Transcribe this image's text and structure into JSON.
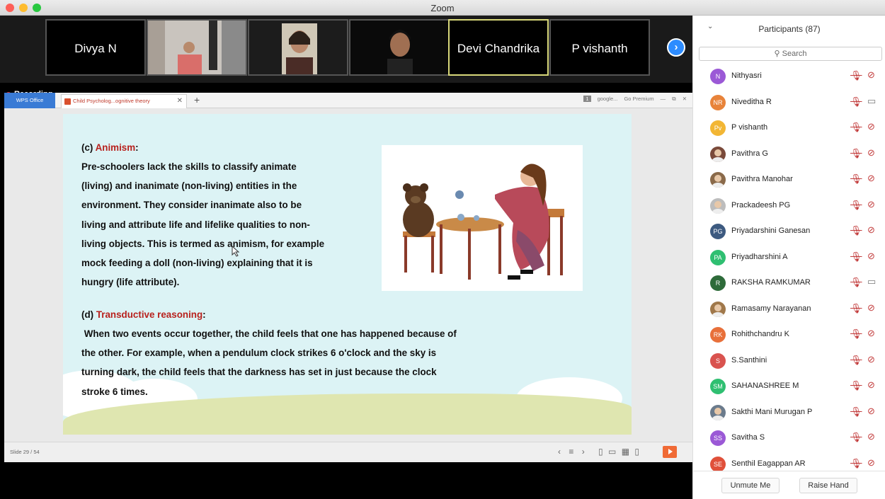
{
  "window": {
    "title": "Zoom"
  },
  "gallery": {
    "tiles": [
      {
        "name": "Divya N",
        "type": "name",
        "active": false
      },
      {
        "name": "",
        "type": "video",
        "active": false
      },
      {
        "name": "",
        "type": "video",
        "active": false
      },
      {
        "name": "",
        "type": "video",
        "active": false
      },
      {
        "name": "Devi Chandrika",
        "type": "name",
        "active": true
      },
      {
        "name": "P vishanth",
        "type": "name",
        "active": false
      }
    ],
    "next_icon": "chevron-right-icon"
  },
  "recording": {
    "label": "Recording"
  },
  "wps": {
    "app_tab": "WPS Office",
    "doc_tab": "Child Psycholog...ognitive theory",
    "new_tab": "+",
    "toolbar_right": {
      "page_box": "1",
      "google": "google...",
      "premium": "Go Premium"
    },
    "status": {
      "slide_count": "Slide 29 / 54"
    }
  },
  "slide": {
    "c_prefix": "(c) ",
    "c_title": "Animism",
    "c_lines": [
      "Pre-schoolers lack the skills to classify animate",
      "(living) and inanimate (non-living) entities in the",
      "environment. They consider inanimate also to be",
      "living and attribute life and lifelike qualities to non-",
      "living objects. This is termed as animism, for example",
      "mock feeding a doll (non-living) explaining that it is",
      "hungry (life attribute)."
    ],
    "d_prefix": "(d) ",
    "d_title": "Transductive reasoning",
    "d_lines": [
      " When two events occur together, the child feels that one has happened because of",
      "the other. For example, when a pendulum clock strikes 6 o'clock and the sky is",
      "turning dark, the child feels that the darkness has set in just because the clock",
      "stroke 6 times."
    ],
    "image_alt": "girl-feeding-teddy-bear-illustration"
  },
  "participants": {
    "title": "Participants (87)",
    "search_placeholder": "Search",
    "items": [
      {
        "name": "Nithyasri",
        "initials": "N",
        "color": "#9b59d6",
        "photo": false,
        "cam_on": false
      },
      {
        "name": "Niveditha R",
        "initials": "NR",
        "color": "#e8833a",
        "photo": false,
        "cam_on": true
      },
      {
        "name": "P vishanth",
        "initials": "Pv",
        "color": "#f2b634",
        "photo": false,
        "cam_on": false
      },
      {
        "name": "Pavithra G",
        "initials": "",
        "color": "#7a4a3a",
        "photo": true,
        "cam_on": false
      },
      {
        "name": "Pavithra Manohar",
        "initials": "",
        "color": "#8a6a4a",
        "photo": true,
        "cam_on": false
      },
      {
        "name": "Prackadeesh PG",
        "initials": "",
        "color": "#bdbdbd",
        "photo": true,
        "cam_on": false
      },
      {
        "name": "Priyadarshini Ganesan",
        "initials": "PG",
        "color": "#3d5a80",
        "photo": false,
        "cam_on": false
      },
      {
        "name": "Priyadharshini A",
        "initials": "PA",
        "color": "#2fbf71",
        "photo": false,
        "cam_on": false
      },
      {
        "name": "RAKSHA RAMKUMAR",
        "initials": "R",
        "color": "#2e6b3a",
        "photo": false,
        "cam_on": true
      },
      {
        "name": "Ramasamy Narayanan",
        "initials": "",
        "color": "#a0784a",
        "photo": true,
        "cam_on": false
      },
      {
        "name": "Rohithchandru K",
        "initials": "RK",
        "color": "#e8703a",
        "photo": false,
        "cam_on": false
      },
      {
        "name": "S.Santhini",
        "initials": "S",
        "color": "#d9534f",
        "photo": false,
        "cam_on": false
      },
      {
        "name": "SAHANASHREE M",
        "initials": "SM",
        "color": "#2fbf71",
        "photo": false,
        "cam_on": false
      },
      {
        "name": "Sakthi Mani Murugan P",
        "initials": "",
        "color": "#6b7b8c",
        "photo": true,
        "cam_on": false
      },
      {
        "name": "Savitha S",
        "initials": "SS",
        "color": "#9b59d6",
        "photo": false,
        "cam_on": false
      },
      {
        "name": "Senthil Eagappan AR",
        "initials": "SE",
        "color": "#e0503a",
        "photo": false,
        "cam_on": false
      }
    ],
    "unmute_label": "Unmute Me",
    "raise_hand_label": "Raise Hand"
  }
}
